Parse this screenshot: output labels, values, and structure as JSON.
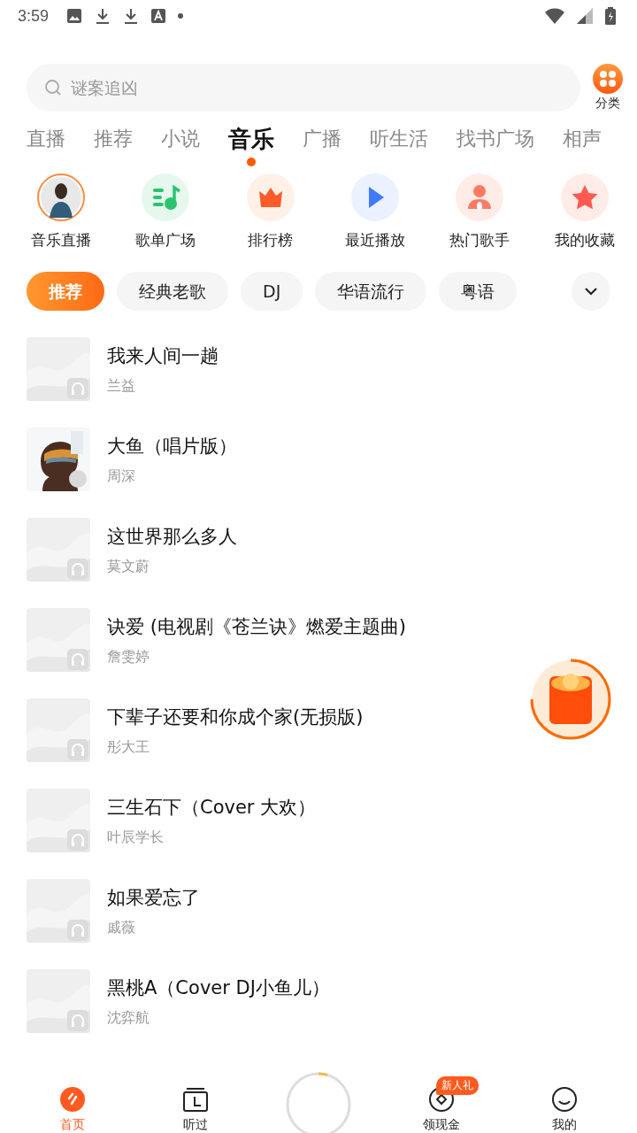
{
  "status_bar": {
    "time": "3:59"
  },
  "search": {
    "placeholder": "谜案追凶"
  },
  "category_button": {
    "label": "分类"
  },
  "tabs": [
    {
      "label": "直播",
      "selected": false
    },
    {
      "label": "推荐",
      "selected": false
    },
    {
      "label": "小说",
      "selected": false
    },
    {
      "label": "音乐",
      "selected": true
    },
    {
      "label": "广播",
      "selected": false
    },
    {
      "label": "听生活",
      "selected": false
    },
    {
      "label": "找书广场",
      "selected": false
    },
    {
      "label": "相声",
      "selected": false
    }
  ],
  "shortcuts": [
    {
      "label": "音乐直播",
      "kind": "avatar"
    },
    {
      "label": "歌单广场",
      "kind": "playlist"
    },
    {
      "label": "排行榜",
      "kind": "crown"
    },
    {
      "label": "最近播放",
      "kind": "play"
    },
    {
      "label": "热门歌手",
      "kind": "singer"
    },
    {
      "label": "我的收藏",
      "kind": "star"
    }
  ],
  "chips": [
    {
      "label": "推荐",
      "selected": true
    },
    {
      "label": "经典老歌",
      "selected": false
    },
    {
      "label": "DJ",
      "selected": false
    },
    {
      "label": "华语流行",
      "selected": false
    },
    {
      "label": "粤语",
      "selected": false
    }
  ],
  "songs": [
    {
      "title": "我来人间一趟",
      "artist": "兰益",
      "kind": "placeholder"
    },
    {
      "title": "大鱼（唱片版）",
      "artist": "周深",
      "kind": "picture"
    },
    {
      "title": "这世界那么多人",
      "artist": "莫文蔚",
      "kind": "placeholder"
    },
    {
      "title": "诀爱 (电视剧《苍兰诀》燃爱主题曲)",
      "artist": "詹雯婷",
      "kind": "placeholder"
    },
    {
      "title": "下辈子还要和你成个家(无损版)",
      "artist": "彤大王",
      "kind": "placeholder"
    },
    {
      "title": "三生石下（Cover 大欢）",
      "artist": "叶辰学长",
      "kind": "placeholder"
    },
    {
      "title": "如果爱忘了",
      "artist": "戚薇",
      "kind": "placeholder"
    },
    {
      "title": "黑桃A（Cover DJ小鱼儿）",
      "artist": "沈弈航",
      "kind": "placeholder"
    }
  ],
  "bottom_nav": [
    {
      "label": "首页",
      "kind": "home",
      "selected": true
    },
    {
      "label": "听过",
      "kind": "history",
      "selected": false
    },
    {
      "kind": "player"
    },
    {
      "label": "领现金",
      "kind": "cash",
      "badge": "新人礼",
      "selected": false
    },
    {
      "label": "我的",
      "kind": "me",
      "selected": false
    }
  ]
}
